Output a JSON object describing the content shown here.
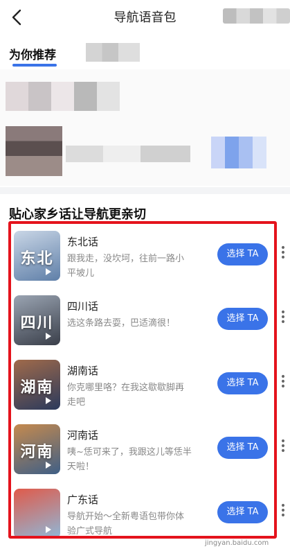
{
  "header": {
    "title": "导航语音包",
    "back_icon": "chevron-left-icon"
  },
  "tabs": {
    "active_label": "为你推荐"
  },
  "section": {
    "title": "贴心家乡话让导航更亲切"
  },
  "items": [
    {
      "thumb_text": "东北",
      "name": "东北话",
      "description": "跟我走，没坎坷，往前一路小平坡儿",
      "button_label": "选择 TA",
      "thumb_colors": [
        "#5f7fa8",
        "#c9d6e6"
      ]
    },
    {
      "thumb_text": "四川",
      "name": "四川话",
      "description": "选这条路去耍，巴适滴很！",
      "button_label": "选择 TA",
      "thumb_colors": [
        "#3a3f4a",
        "#9aa4b2"
      ]
    },
    {
      "thumb_text": "湖南",
      "name": "湖南话",
      "description": "你克哪里咯？在我这歇歇脚再走吧",
      "button_label": "选择 TA",
      "thumb_colors": [
        "#2b3a5c",
        "#a06a4a"
      ]
    },
    {
      "thumb_text": "河南",
      "name": "河南话",
      "description": "咦~恁可来了，我跟这儿等恁半天啦！",
      "button_label": "选择 TA",
      "thumb_colors": [
        "#3f5f86",
        "#c58a4e"
      ]
    },
    {
      "thumb_text": "",
      "name": "广东话",
      "description": "导航开始～全新粤语包带你体验广式导航",
      "button_label": "选择 TA",
      "thumb_colors": [
        "#8fb8d8",
        "#e05a4a"
      ]
    }
  ],
  "watermark": "jingyan.baidu.com",
  "colors": {
    "accent": "#3a73e8",
    "highlight": "#e4131c"
  }
}
